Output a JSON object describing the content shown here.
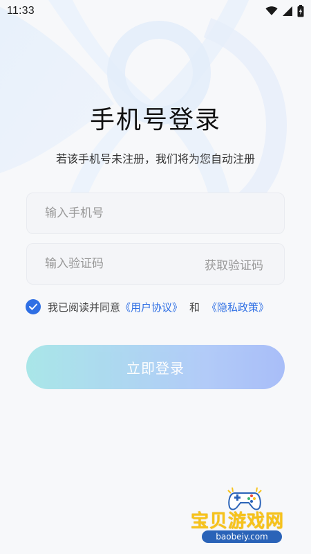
{
  "status_bar": {
    "time": "11:33",
    "icons": [
      "wifi-icon",
      "signal-icon",
      "battery-icon"
    ]
  },
  "login": {
    "title": "手机号登录",
    "subtitle": "若该手机号未注册，我们将为您自动注册",
    "phone": {
      "placeholder": "输入手机号",
      "value": ""
    },
    "code": {
      "placeholder": "输入验证码",
      "value": "",
      "get_code_label": "获取验证码"
    },
    "agreement": {
      "checked": true,
      "prefix": "我已阅读并同意",
      "user_agreement": "《用户协议》",
      "and": "和",
      "privacy_policy": "《隐私政策》"
    },
    "submit_label": "立即登录"
  },
  "watermark": {
    "brand": "宝贝游戏网",
    "url": "baobeiy.com"
  },
  "colors": {
    "accent": "#2f6fe4",
    "button_gradient_start": "#8fe0e2",
    "button_gradient_end": "#8eaaf8",
    "background": "#f7f8fa",
    "placeholder": "#999999"
  }
}
